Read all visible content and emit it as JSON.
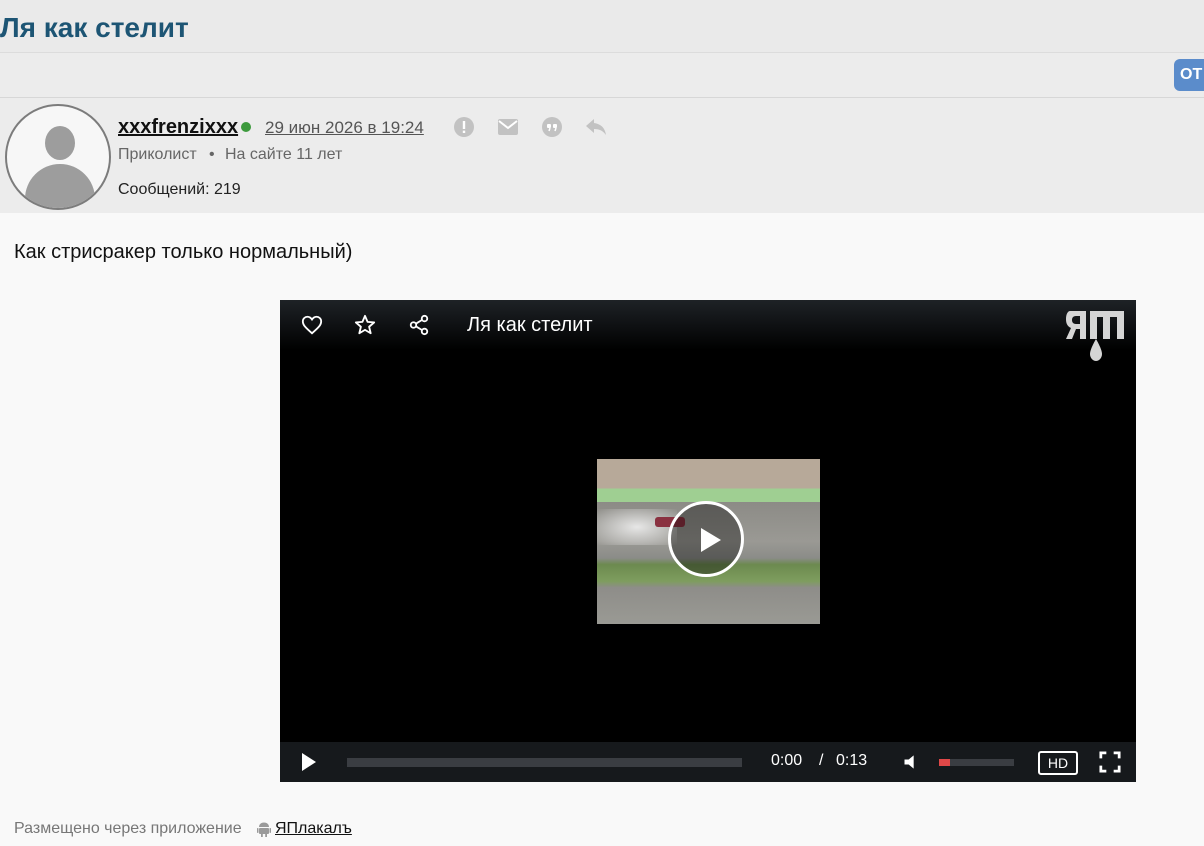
{
  "topic": {
    "title": "Ля как стелит"
  },
  "toolbar": {
    "reply_label": "ОТ"
  },
  "post": {
    "author": "xxxfrenzixxx",
    "date": "29 июн 2026 в 19:24",
    "rank": "Приколист",
    "separator": "•",
    "since": "На сайте 11 лет",
    "post_count": "Сообщений: 219",
    "text": "Как стрисракер только нормальный)",
    "actions": [
      "report-icon",
      "mail-icon",
      "quote-icon",
      "reply-icon"
    ],
    "online_color": "#3d9a3d"
  },
  "player": {
    "title": "Ля как стелит",
    "current_time": "0:00",
    "time_separator": "/",
    "duration": "0:13",
    "hd_label": "HD",
    "progress_fraction": 0.0,
    "volume_fraction": 0.15,
    "accent_color": "#e04848"
  },
  "footer": {
    "note": "Размещено через приложение",
    "app_name": "ЯПлакалъ"
  }
}
